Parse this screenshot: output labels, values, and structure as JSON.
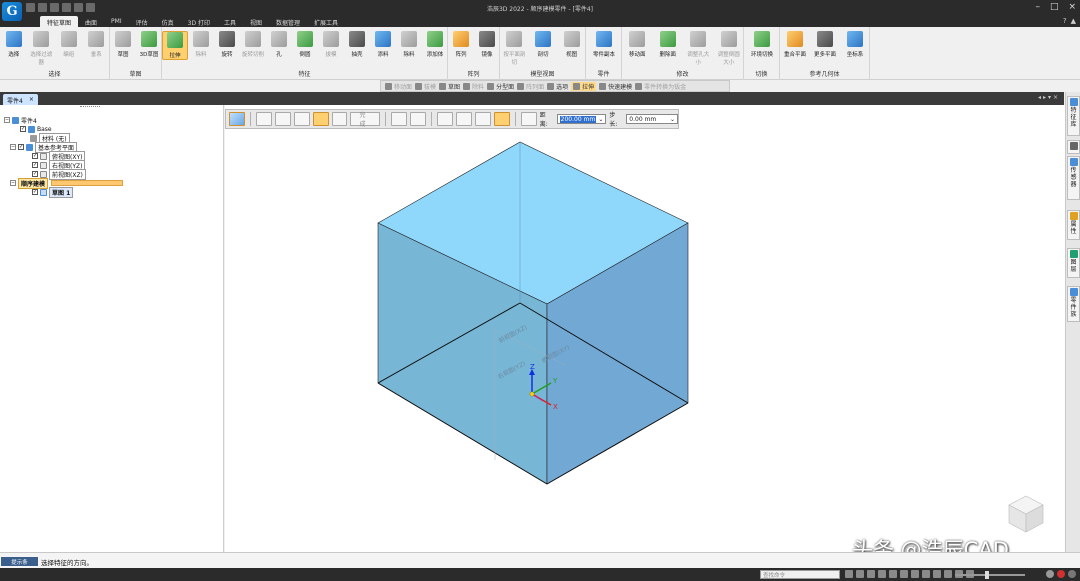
{
  "window": {
    "title": "浩辰3D 2022 - 顺序建模零件 - [零件4]",
    "logo_letter": "G"
  },
  "menu_tabs": [
    "特征草图",
    "曲面",
    "PMI",
    "评估",
    "仿真",
    "3D 打印",
    "工具",
    "视图",
    "数据管理",
    "扩展工具"
  ],
  "active_tab": "特征草图",
  "ribbon": {
    "groups": [
      {
        "label": "选择",
        "tools": [
          {
            "label": "选择",
            "icon": "select-arrow-icon"
          },
          {
            "label": "选择过滤器",
            "icon": "filter-icon",
            "disabled": true
          },
          {
            "label": "编组",
            "icon": "group-icon",
            "disabled": true
          },
          {
            "label": "垂系",
            "icon": "vertical-icon",
            "disabled": true
          }
        ]
      },
      {
        "label": "草图",
        "tools": [
          {
            "label": "草图",
            "icon": "sketch-icon"
          },
          {
            "label": "3D草图",
            "icon": "sketch-3d-icon"
          }
        ]
      },
      {
        "label": "特征",
        "tools": [
          {
            "label": "拉伸",
            "icon": "extrude-icon",
            "active": true
          },
          {
            "label": "除料",
            "icon": "cut-icon",
            "disabled": true
          },
          {
            "label": "旋转",
            "icon": "revolve-icon"
          },
          {
            "label": "旋转切削",
            "icon": "revolve-cut-icon",
            "disabled": true
          },
          {
            "label": "孔",
            "icon": "hole-icon"
          },
          {
            "label": "倒圆",
            "icon": "round-icon"
          },
          {
            "label": "拔模",
            "icon": "draft-icon",
            "disabled": true
          },
          {
            "label": "抽壳",
            "icon": "shell-icon"
          },
          {
            "label": "添料",
            "icon": "add-material-icon"
          },
          {
            "label": "除料",
            "icon": "remove-material-icon"
          },
          {
            "label": "添加体",
            "icon": "add-body-icon"
          }
        ]
      },
      {
        "label": "阵列",
        "tools": [
          {
            "label": "阵列",
            "icon": "pattern-icon"
          },
          {
            "label": "镜像",
            "icon": "mirror-icon"
          }
        ]
      },
      {
        "label": "模型视图",
        "tools": [
          {
            "label": "按平面剖切",
            "icon": "plane-section-icon",
            "disabled": true
          },
          {
            "label": "剖切",
            "icon": "section-icon"
          },
          {
            "label": "视图",
            "icon": "view-icon"
          }
        ]
      },
      {
        "label": "零件",
        "tools": [
          {
            "label": "零件副本",
            "icon": "part-copy-icon"
          }
        ]
      },
      {
        "label": "修改",
        "tools": [
          {
            "label": "移动面",
            "icon": "move-face-icon"
          },
          {
            "label": "删除面",
            "icon": "delete-face-icon"
          },
          {
            "label": "调整孔大小",
            "icon": "resize-hole-icon",
            "disabled": true
          },
          {
            "label": "调整倒圆大小",
            "icon": "resize-round-icon",
            "disabled": true
          }
        ]
      },
      {
        "label": "切换",
        "tools": [
          {
            "label": "环境切换",
            "icon": "env-switch-icon"
          }
        ]
      },
      {
        "label": "参考几何体",
        "tools": [
          {
            "label": "重合平面",
            "icon": "coincident-plane-icon"
          },
          {
            "label": "更多平面",
            "icon": "more-planes-icon"
          },
          {
            "label": "坐标系",
            "icon": "coord-system-icon"
          }
        ]
      }
    ]
  },
  "subtoolbar": [
    {
      "label": "移动面",
      "disabled": true
    },
    {
      "label": "拔模",
      "disabled": true
    },
    {
      "label": "草图",
      "disabled": false
    },
    {
      "label": "除料",
      "disabled": true
    },
    {
      "label": "分型面",
      "disabled": false
    },
    {
      "label": "阵列面",
      "disabled": true
    },
    {
      "label": "选项",
      "disabled": false
    },
    {
      "label": "拉伸",
      "disabled": false,
      "active": true
    },
    {
      "label": "快速建模",
      "disabled": false
    },
    {
      "label": "零件转换为钣金",
      "disabled": true
    }
  ],
  "doc_tab": {
    "label": "零件4",
    "close": "×"
  },
  "tree": {
    "root": "零件4",
    "base": "Base",
    "material": "材料 (无)",
    "ref_planes_group": "基本参考平面",
    "planes": [
      "俯视图(XY)",
      "右视图(YZ)",
      "前视图(XZ)"
    ],
    "sequence_group": "顺序建模",
    "sketch": "草图 1"
  },
  "feature_bar": {
    "done_label": "完成",
    "distance_label": "距离:",
    "distance_value": "200.00 mm",
    "step_label": "步长:",
    "step_value": "0.00 mm"
  },
  "viewport": {
    "cube_top_color": "#8fd8fc",
    "cube_left_color": "#78b6d6",
    "cube_right_color": "#72a8d4",
    "plane_labels": [
      "前视图(XZ)",
      "右视图(YZ)",
      "俯视图(XY)"
    ],
    "axis_x": "X",
    "axis_y": "Y",
    "axis_z": "Z"
  },
  "right_panel": [
    "特征库",
    "图层",
    "传感器",
    "属性",
    "零件族"
  ],
  "status": {
    "prompt_tag": "提示条",
    "prompt_text": "选择特征的方向。",
    "search_placeholder": "查找命令"
  },
  "watermark": "头条 @浩辰CAD"
}
